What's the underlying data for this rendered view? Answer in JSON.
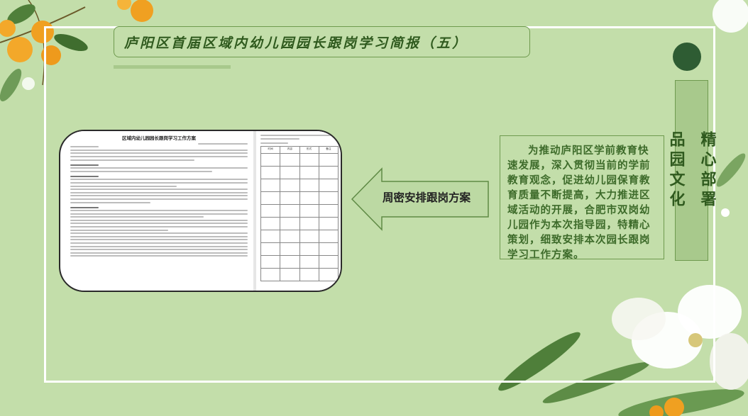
{
  "header": {
    "title": "庐阳区首届区域内幼儿园园长跟岗学习简报（五）"
  },
  "side_title": {
    "text": "精心部署\n\n品园文化"
  },
  "arrow": {
    "label": "周密安排跟岗方案"
  },
  "description": {
    "text": "为推动庐阳区学前教育快速发展，深入贯彻当前的学前教育观念，促进幼儿园保育教育质量不断提高，大力推进区域活动的开展，合肥市双岗幼儿园作为本次指导园，特精心策划，细致安排本次园长跟岗学习工作方案。"
  },
  "document_preview": {
    "title": "区域内幼儿园园长跟岗学习工作方案",
    "table_headers": [
      "时间",
      "内容",
      "形式",
      "备注"
    ]
  },
  "colors": {
    "background": "#c3deaa",
    "accent_dark": "#2e5c33",
    "text_green": "#3d6b2a"
  }
}
